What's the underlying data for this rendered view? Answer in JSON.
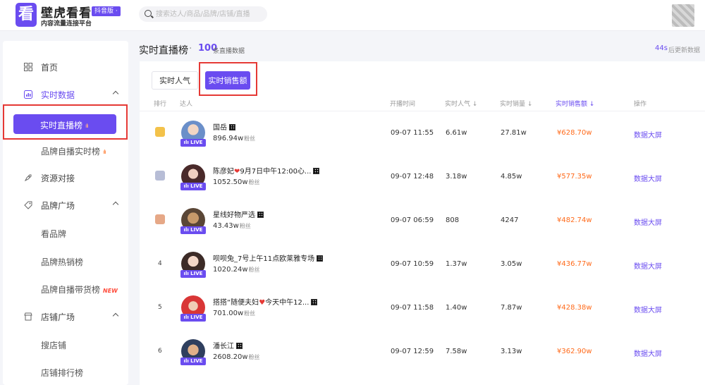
{
  "header": {
    "logo_char": "看",
    "brand_name": "壁虎看看",
    "brand_badge": "抖音版 ·",
    "brand_subtitle": "内容流量连接平台",
    "search_placeholder": "搜索达人/商品/品牌/店铺/直播"
  },
  "sidebar": {
    "items": [
      {
        "label": "首页",
        "icon": "grid-icon"
      },
      {
        "label": "实时数据",
        "icon": "chart-icon"
      },
      {
        "label": "实时直播榜",
        "active": true,
        "badge": "ılı"
      },
      {
        "label": "品牌自播实时榜",
        "badge": "ılı"
      },
      {
        "label": "资源对接",
        "icon": "rocket-icon"
      },
      {
        "label": "品牌广场",
        "icon": "tag-icon"
      },
      {
        "label": "看品牌"
      },
      {
        "label": "品牌热销榜"
      },
      {
        "label": "品牌自播带货榜",
        "badge": "NEW"
      },
      {
        "label": "店铺广场",
        "icon": "store-icon"
      },
      {
        "label": "搜店铺"
      },
      {
        "label": "店铺排行榜"
      }
    ]
  },
  "main": {
    "title": "实时直播榜",
    "dot": "·",
    "count": "100",
    "count_label": "条直播数据",
    "update_seconds": "44s",
    "update_label": "后更新数据",
    "tabs": [
      "实时人气",
      "实时销售额"
    ],
    "columns": [
      "排行",
      "达人",
      "开播时间",
      "实时人气 ↓",
      "实时销量 ↓",
      "实时销售额 ↓",
      "操作"
    ],
    "live_label": "ılı LIVE",
    "fans_label": "粉丝",
    "rows": [
      {
        "rank": "1",
        "name": "国岳",
        "fans": "896.94w",
        "time": "09-07 11:55",
        "popularity": "6.61w",
        "sales": "27.81w",
        "amount": "¥628.70w",
        "action": "数据大屏"
      },
      {
        "rank": "2",
        "name": "陈彦妃",
        "name_suffix": "9月7日中午12:00心...",
        "fans": "1052.50w",
        "time": "09-07 12:48",
        "popularity": "3.18w",
        "sales": "4.85w",
        "amount": "¥577.35w",
        "action": "数据大屏"
      },
      {
        "rank": "3",
        "name": "星线好物严选",
        "fans": "43.43w",
        "time": "09-07 06:59",
        "popularity": "808",
        "sales": "4247",
        "amount": "¥482.74w",
        "action": "数据大屏"
      },
      {
        "rank": "4",
        "name": "呗呗兔_7号上午11点欧莱雅专场",
        "fans": "1020.24w",
        "time": "09-07 10:59",
        "popularity": "1.37w",
        "sales": "3.05w",
        "amount": "¥436.77w",
        "action": "数据大屏"
      },
      {
        "rank": "5",
        "name": "搭搭“随便夫妇",
        "name_suffix": "今天中午12...",
        "fans": "701.00w",
        "time": "09-07 11:58",
        "popularity": "1.40w",
        "sales": "7.87w",
        "amount": "¥428.38w",
        "action": "数据大屏"
      },
      {
        "rank": "6",
        "name": "潘长江",
        "fans": "2608.20w",
        "time": "09-07 12:59",
        "popularity": "7.58w",
        "sales": "3.13w",
        "amount": "¥362.90w",
        "action": "数据大屏"
      }
    ]
  }
}
